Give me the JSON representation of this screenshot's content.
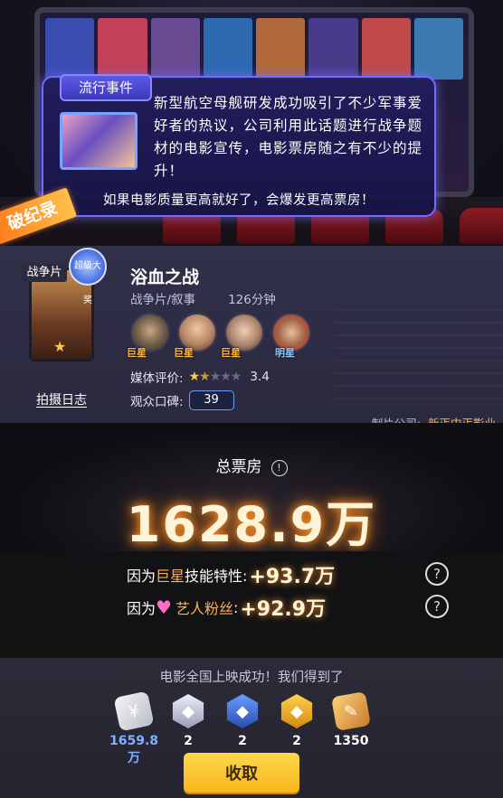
{
  "event": {
    "tag": "流行事件",
    "text": "新型航空母舰研发成功吸引了不少军事爱好者的热议，公司利用此话题进行战争题材的电影宣传，电影票房随之有不少的提升！",
    "footer": "如果电影质量更高就好了，会爆发更高票房！"
  },
  "record_banner": "破纪录",
  "movie": {
    "genre_tag": "战争片",
    "award_badge": "超级大奖",
    "title": "浴血之战",
    "genre": "战争片/叙事",
    "duration": "126分钟",
    "cast": [
      {
        "label": "巨星",
        "icon": "actor-avatar"
      },
      {
        "label": "巨星",
        "icon": "actor-avatar"
      },
      {
        "label": "巨星",
        "icon": "actor-avatar"
      },
      {
        "label": "明星",
        "icon": "actor-avatar"
      }
    ],
    "media_rating_label": "媒体评价:",
    "media_rating_stars": 1.5,
    "media_rating_value": "3.4",
    "audience_label": "观众口碑:",
    "audience_value": "39",
    "log_link": "拍摄日志",
    "studio_label": "制片公司:",
    "studio_name": "新丐中丐影业"
  },
  "box_office": {
    "label": "总票房",
    "value": "1628.9万"
  },
  "bonuses": [
    {
      "prefix": "因为",
      "highlight": "巨星",
      "suffix": "技能特性:",
      "amount": "+93.7万"
    },
    {
      "prefix": "因为",
      "highlight": "艺人粉丝",
      "suffix": ":",
      "amount": "+92.9万"
    }
  ],
  "rewards": {
    "title": "电影全国上映成功！我们得到了",
    "items": [
      {
        "icon": "cash-icon",
        "count": "1659.8万",
        "color": "#e8e8e8"
      },
      {
        "icon": "silver-gem-icon",
        "count": "2",
        "color": "#c9cbe0"
      },
      {
        "icon": "blue-gem-icon",
        "count": "2",
        "color": "#3d6de0"
      },
      {
        "icon": "gold-gem-icon",
        "count": "2",
        "color": "#f2a21a"
      },
      {
        "icon": "book-icon",
        "count": "1350",
        "color": "#f0b45a"
      }
    ],
    "collect_button": "收取"
  }
}
